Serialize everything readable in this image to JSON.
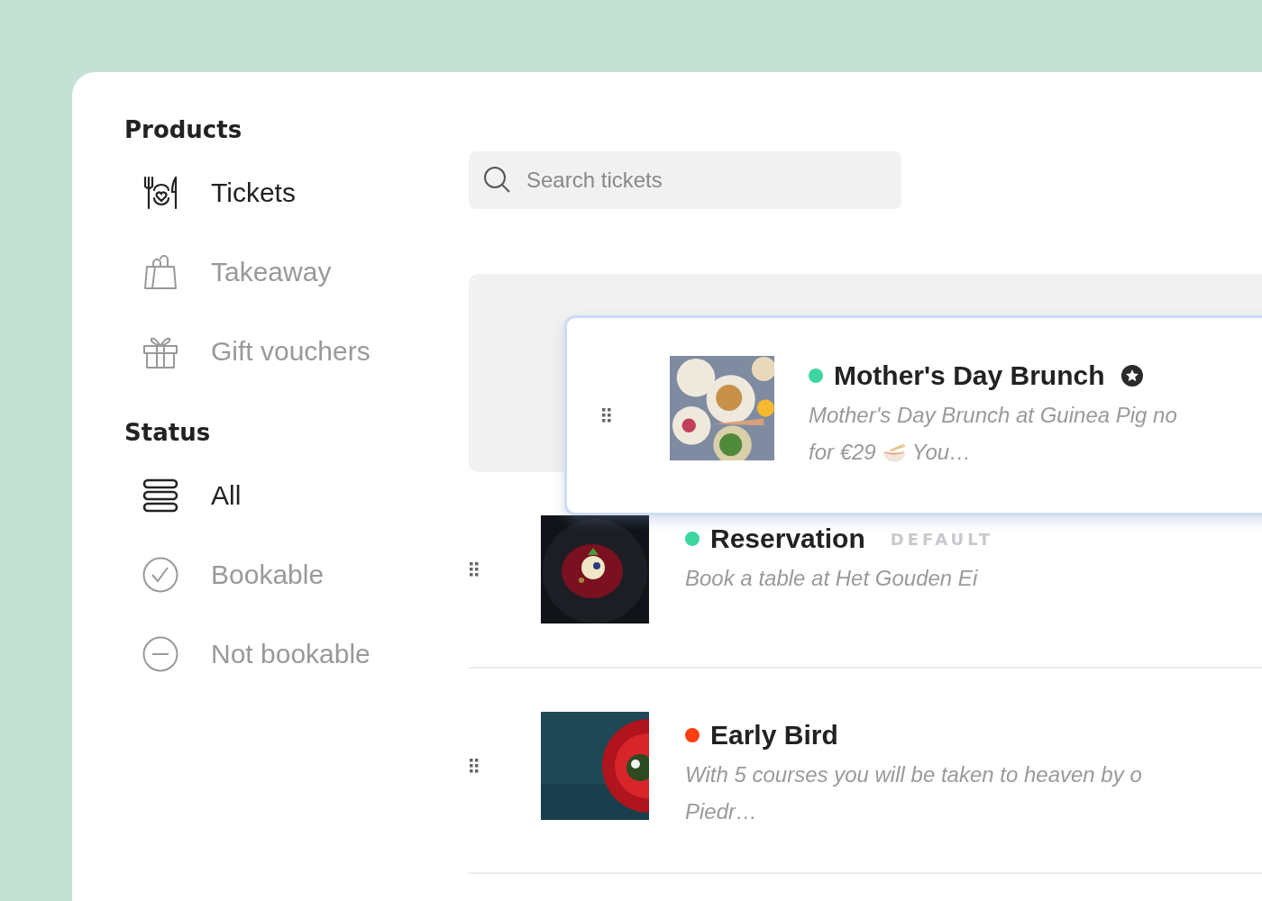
{
  "sidebar": {
    "sections": [
      {
        "heading": "Products",
        "items": [
          {
            "label": "Tickets",
            "kind": "ticket",
            "selected": true
          },
          {
            "label": "Takeaway",
            "kind": "bag",
            "selected": false
          },
          {
            "label": "Gift vouchers",
            "kind": "gift",
            "selected": false
          }
        ]
      },
      {
        "heading": "Status",
        "items": [
          {
            "label": "All",
            "kind": "list",
            "selected": true
          },
          {
            "label": "Bookable",
            "kind": "check",
            "selected": false
          },
          {
            "label": "Not bookable",
            "kind": "minus",
            "selected": false
          }
        ]
      }
    ]
  },
  "search": {
    "placeholder": "Search tickets"
  },
  "dragged_ticket": {
    "title": "Mother's Day Brunch",
    "color": "#3dd6a0",
    "featured": true,
    "description_lines": [
      [
        {
          "kind": "text",
          "text": "Mother's Day Brunch at Guinea Pig no"
        }
      ],
      [
        {
          "kind": "text",
          "text": "for €29"
        },
        {
          "kind": "bowl"
        },
        {
          "kind": "text",
          "text": "You…"
        }
      ]
    ]
  },
  "tickets": [
    {
      "title": "Reservation",
      "color": "#3dd6a0",
      "badge": "DEFAULT",
      "description_lines": [
        [
          {
            "kind": "text",
            "text": "Book a table at Het Gouden Ei"
          }
        ]
      ]
    },
    {
      "title": "Early Bird",
      "color": "#ff3d12",
      "description_lines": [
        [
          {
            "kind": "text",
            "text": "With 5 courses you will be taken to heaven by o"
          }
        ],
        [
          {
            "kind": "text",
            "text": "Piedr…"
          }
        ]
      ]
    }
  ]
}
